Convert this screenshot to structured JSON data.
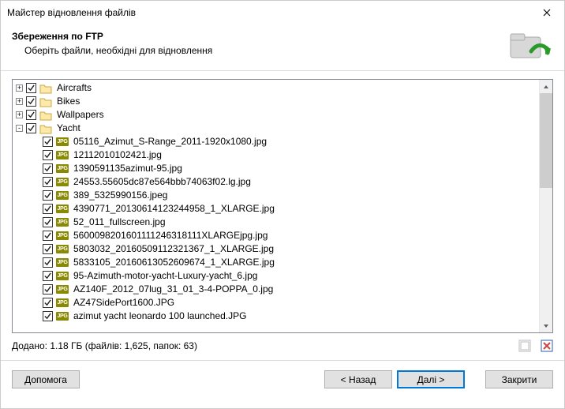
{
  "window": {
    "title": "Майстер відновлення файлів"
  },
  "header": {
    "title": "Збереження по FTP",
    "subtitle": "Оберіть файли, необхідні для відновлення"
  },
  "tree": {
    "folders": [
      {
        "expand": "+",
        "name": "Aircrafts"
      },
      {
        "expand": "+",
        "name": "Bikes"
      },
      {
        "expand": "+",
        "name": "Wallpapers"
      },
      {
        "expand": "-",
        "name": "Yacht"
      }
    ],
    "files": [
      "05116_Azimut_S-Range_2011-1920x1080.jpg",
      "12112010102421.jpg",
      "1390591135azimut-95.jpg",
      "24553.55605dc87e564bbb74063f02.lg.jpg",
      "389_5325990156.jpeg",
      "4390771_20130614123244958_1_XLARGE.jpg",
      "52_011_fullscreen.jpg",
      "5600098201601111246318111XLARGEjpg.jpg",
      "5803032_20160509112321367_1_XLARGE.jpg",
      "5833105_20160613052609674_1_XLARGE.jpg",
      "95-Azimuth-motor-yacht-Luxury-yacht_6.jpg",
      "AZ140F_2012_07lug_31_01_3-4-POPPA_0.jpg",
      "AZ47SidePort1600.JPG",
      "azimut yacht leonardo 100 launched.JPG"
    ]
  },
  "status": {
    "text": "Додано: 1.18 ГБ (файлів: 1,625, папок: 63)"
  },
  "footer": {
    "help": "Допомога",
    "back": "< Назад",
    "next": "Далі >",
    "close": "Закрити"
  },
  "icons": {
    "jpg_badge": "JPG"
  }
}
